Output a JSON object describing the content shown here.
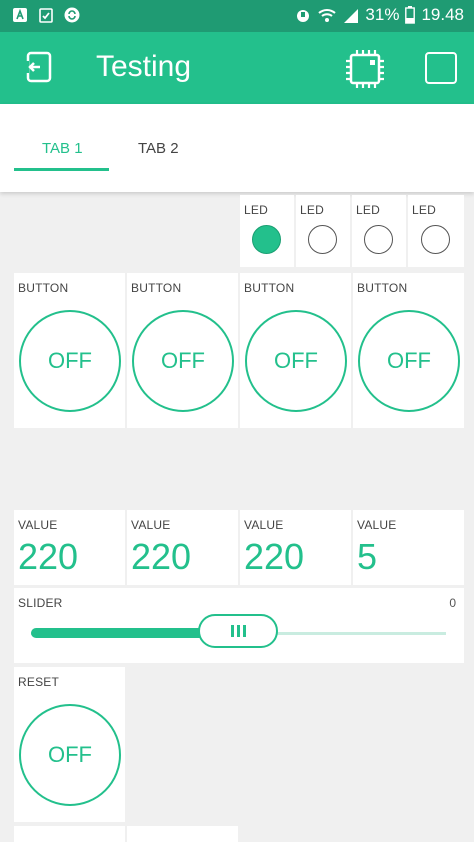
{
  "status_bar": {
    "battery": "31%",
    "time": "19.48",
    "left_icons": [
      "a-icon",
      "clipboard-check-icon",
      "sync-icon"
    ],
    "right_icons": [
      "alarm-icon",
      "wifi-icon",
      "signal-icon",
      "battery-icon"
    ]
  },
  "app_bar": {
    "title": "Testing",
    "accent": "#23c08c",
    "dark": "#1f9b73"
  },
  "tabs": [
    {
      "label": "TAB 1",
      "active": true
    },
    {
      "label": "TAB 2",
      "active": false
    }
  ],
  "leds": [
    {
      "label": "LED",
      "on": true
    },
    {
      "label": "LED",
      "on": false
    },
    {
      "label": "LED",
      "on": false
    },
    {
      "label": "LED",
      "on": false
    }
  ],
  "buttons": [
    {
      "label": "BUTTON",
      "state": "OFF"
    },
    {
      "label": "BUTTON",
      "state": "OFF"
    },
    {
      "label": "BUTTON",
      "state": "OFF"
    },
    {
      "label": "BUTTON",
      "state": "OFF"
    }
  ],
  "values": [
    {
      "label": "VALUE",
      "value": "220"
    },
    {
      "label": "VALUE",
      "value": "220"
    },
    {
      "label": "VALUE",
      "value": "220"
    },
    {
      "label": "VALUE",
      "value": "5"
    }
  ],
  "slider": {
    "label": "SLIDER",
    "value": "0",
    "fill_fraction": 0.45
  },
  "reset": {
    "label": "RESET",
    "state": "OFF"
  }
}
